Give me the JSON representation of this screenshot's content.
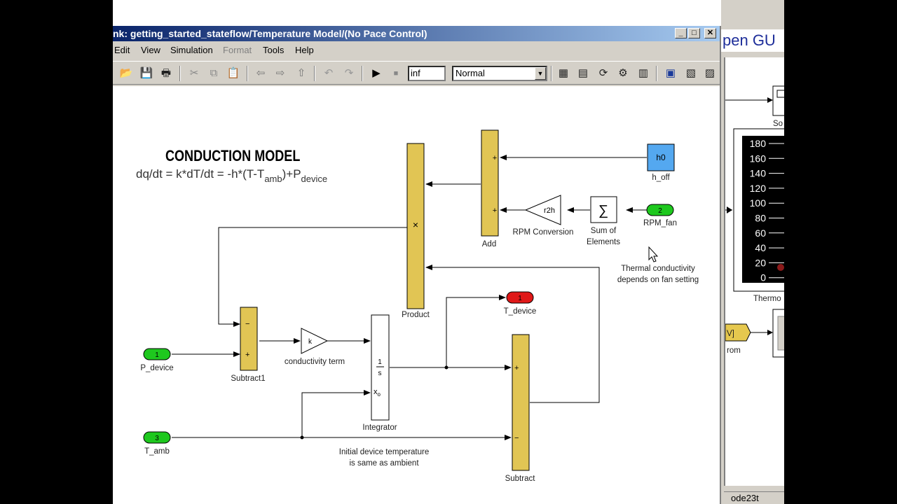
{
  "window": {
    "title": "nk: getting_started_stateflow/Temperature Model/(No Pace Control)",
    "minimize": "_",
    "maximize": "□",
    "close": "✕"
  },
  "menu": [
    "Edit",
    "View",
    "Simulation",
    "Format",
    "Tools",
    "Help"
  ],
  "toolbar": {
    "stop_time": "inf",
    "sim_mode": "Normal"
  },
  "background_window": {
    "title": "pen GU",
    "status": "ode23t",
    "gauge_ticks": [
      "180",
      "160",
      "140",
      "120",
      "100",
      "80",
      "60",
      "40",
      "20",
      "0"
    ],
    "labels": {
      "scope": "So",
      "thermo": "Thermo",
      "from_tag": "V]",
      "from": "rom"
    }
  },
  "model": {
    "heading": "CONDUCTION MODEL",
    "equation": {
      "part1": "dq/dt = k*dT/dt = -h*(T-T",
      "sub1": "amb",
      "part2": ")+P",
      "sub2": "device"
    },
    "blocks": {
      "h0": {
        "text": "h0",
        "label": "h_off"
      },
      "rpm_fan": {
        "port": "2",
        "label": "RPM_fan"
      },
      "sum_elements": {
        "label1": "Sum of",
        "label2": "Elements"
      },
      "rpm_conversion": {
        "text": "r2h",
        "label": "RPM Conversion"
      },
      "add": {
        "label": "Add",
        "in1": "+",
        "in2": "+"
      },
      "product": {
        "label": "Product",
        "op": "×"
      },
      "t_device_out": {
        "port": "1",
        "label": "T_device"
      },
      "p_device": {
        "port": "1",
        "label": "P_device"
      },
      "t_amb": {
        "port": "3",
        "label": "T_amb"
      },
      "subtract1": {
        "label": "Subtract1",
        "in1": "−",
        "in2": "+"
      },
      "gain_k": {
        "text": "k",
        "label": "conductivity term"
      },
      "integrator": {
        "label": "Integrator",
        "frac_top": "1",
        "frac_bottom": "s",
        "x0": "x",
        "x0_sub": "o"
      },
      "subtract": {
        "label": "Subtract",
        "in1": "+",
        "in2": "−"
      }
    },
    "notes": {
      "thermal": [
        "Thermal conductivity",
        "depends on fan setting"
      ],
      "initial": [
        "Initial device temperature",
        "is same as ambient"
      ]
    }
  }
}
